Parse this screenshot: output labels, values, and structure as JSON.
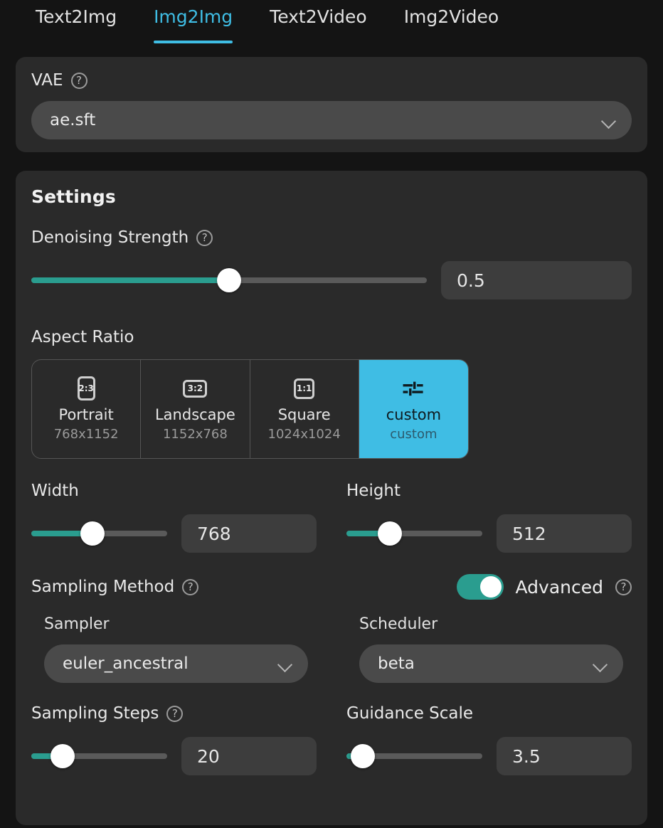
{
  "tabs": [
    {
      "label": "Text2Img",
      "active": false
    },
    {
      "label": "Img2Img",
      "active": true
    },
    {
      "label": "Text2Video",
      "active": false
    },
    {
      "label": "Img2Video",
      "active": false
    }
  ],
  "vae": {
    "label": "VAE",
    "help_icon": "help-circle-icon",
    "selected": "ae.sft",
    "chevron_icon": "chevron-down-icon"
  },
  "settings": {
    "title": "Settings",
    "denoising": {
      "label": "Denoising Strength",
      "help_icon": "help-circle-icon",
      "value": "0.5",
      "percent": 50
    },
    "aspect_ratio": {
      "label": "Aspect Ratio",
      "options": [
        {
          "icon": "ratio-2-3-icon",
          "badge": "2:3",
          "name": "Portrait",
          "dimensions": "768x1152",
          "selected": false
        },
        {
          "icon": "ratio-3-2-icon",
          "badge": "3:2",
          "name": "Landscape",
          "dimensions": "1152x768",
          "selected": false
        },
        {
          "icon": "ratio-1-1-icon",
          "badge": "1:1",
          "name": "Square",
          "dimensions": "1024x1024",
          "selected": false
        },
        {
          "icon": "sliders-icon",
          "badge": "",
          "name": "custom",
          "dimensions": "custom",
          "selected": true
        }
      ]
    },
    "width": {
      "label": "Width",
      "value": "768",
      "percent": 45
    },
    "height": {
      "label": "Height",
      "value": "512",
      "percent": 32
    },
    "sampling_method": {
      "label": "Sampling Method",
      "help_icon": "help-circle-icon"
    },
    "advanced": {
      "label": "Advanced",
      "help_icon": "help-circle-icon",
      "enabled": true
    },
    "sampler": {
      "label": "Sampler",
      "selected": "euler_ancestral",
      "chevron_icon": "chevron-down-icon"
    },
    "scheduler": {
      "label": "Scheduler",
      "selected": "beta",
      "chevron_icon": "chevron-down-icon"
    },
    "sampling_steps": {
      "label": "Sampling Steps",
      "help_icon": "help-circle-icon",
      "value": "20",
      "percent": 23
    },
    "guidance_scale": {
      "label": "Guidance Scale",
      "value": "3.5",
      "percent": 12
    }
  },
  "colors": {
    "accent_blue": "#3fbde4",
    "accent_green": "#2a9d8f",
    "page_bg": "#141414",
    "panel_bg": "#2a2a2a",
    "input_bg": "#3d3d3d"
  }
}
